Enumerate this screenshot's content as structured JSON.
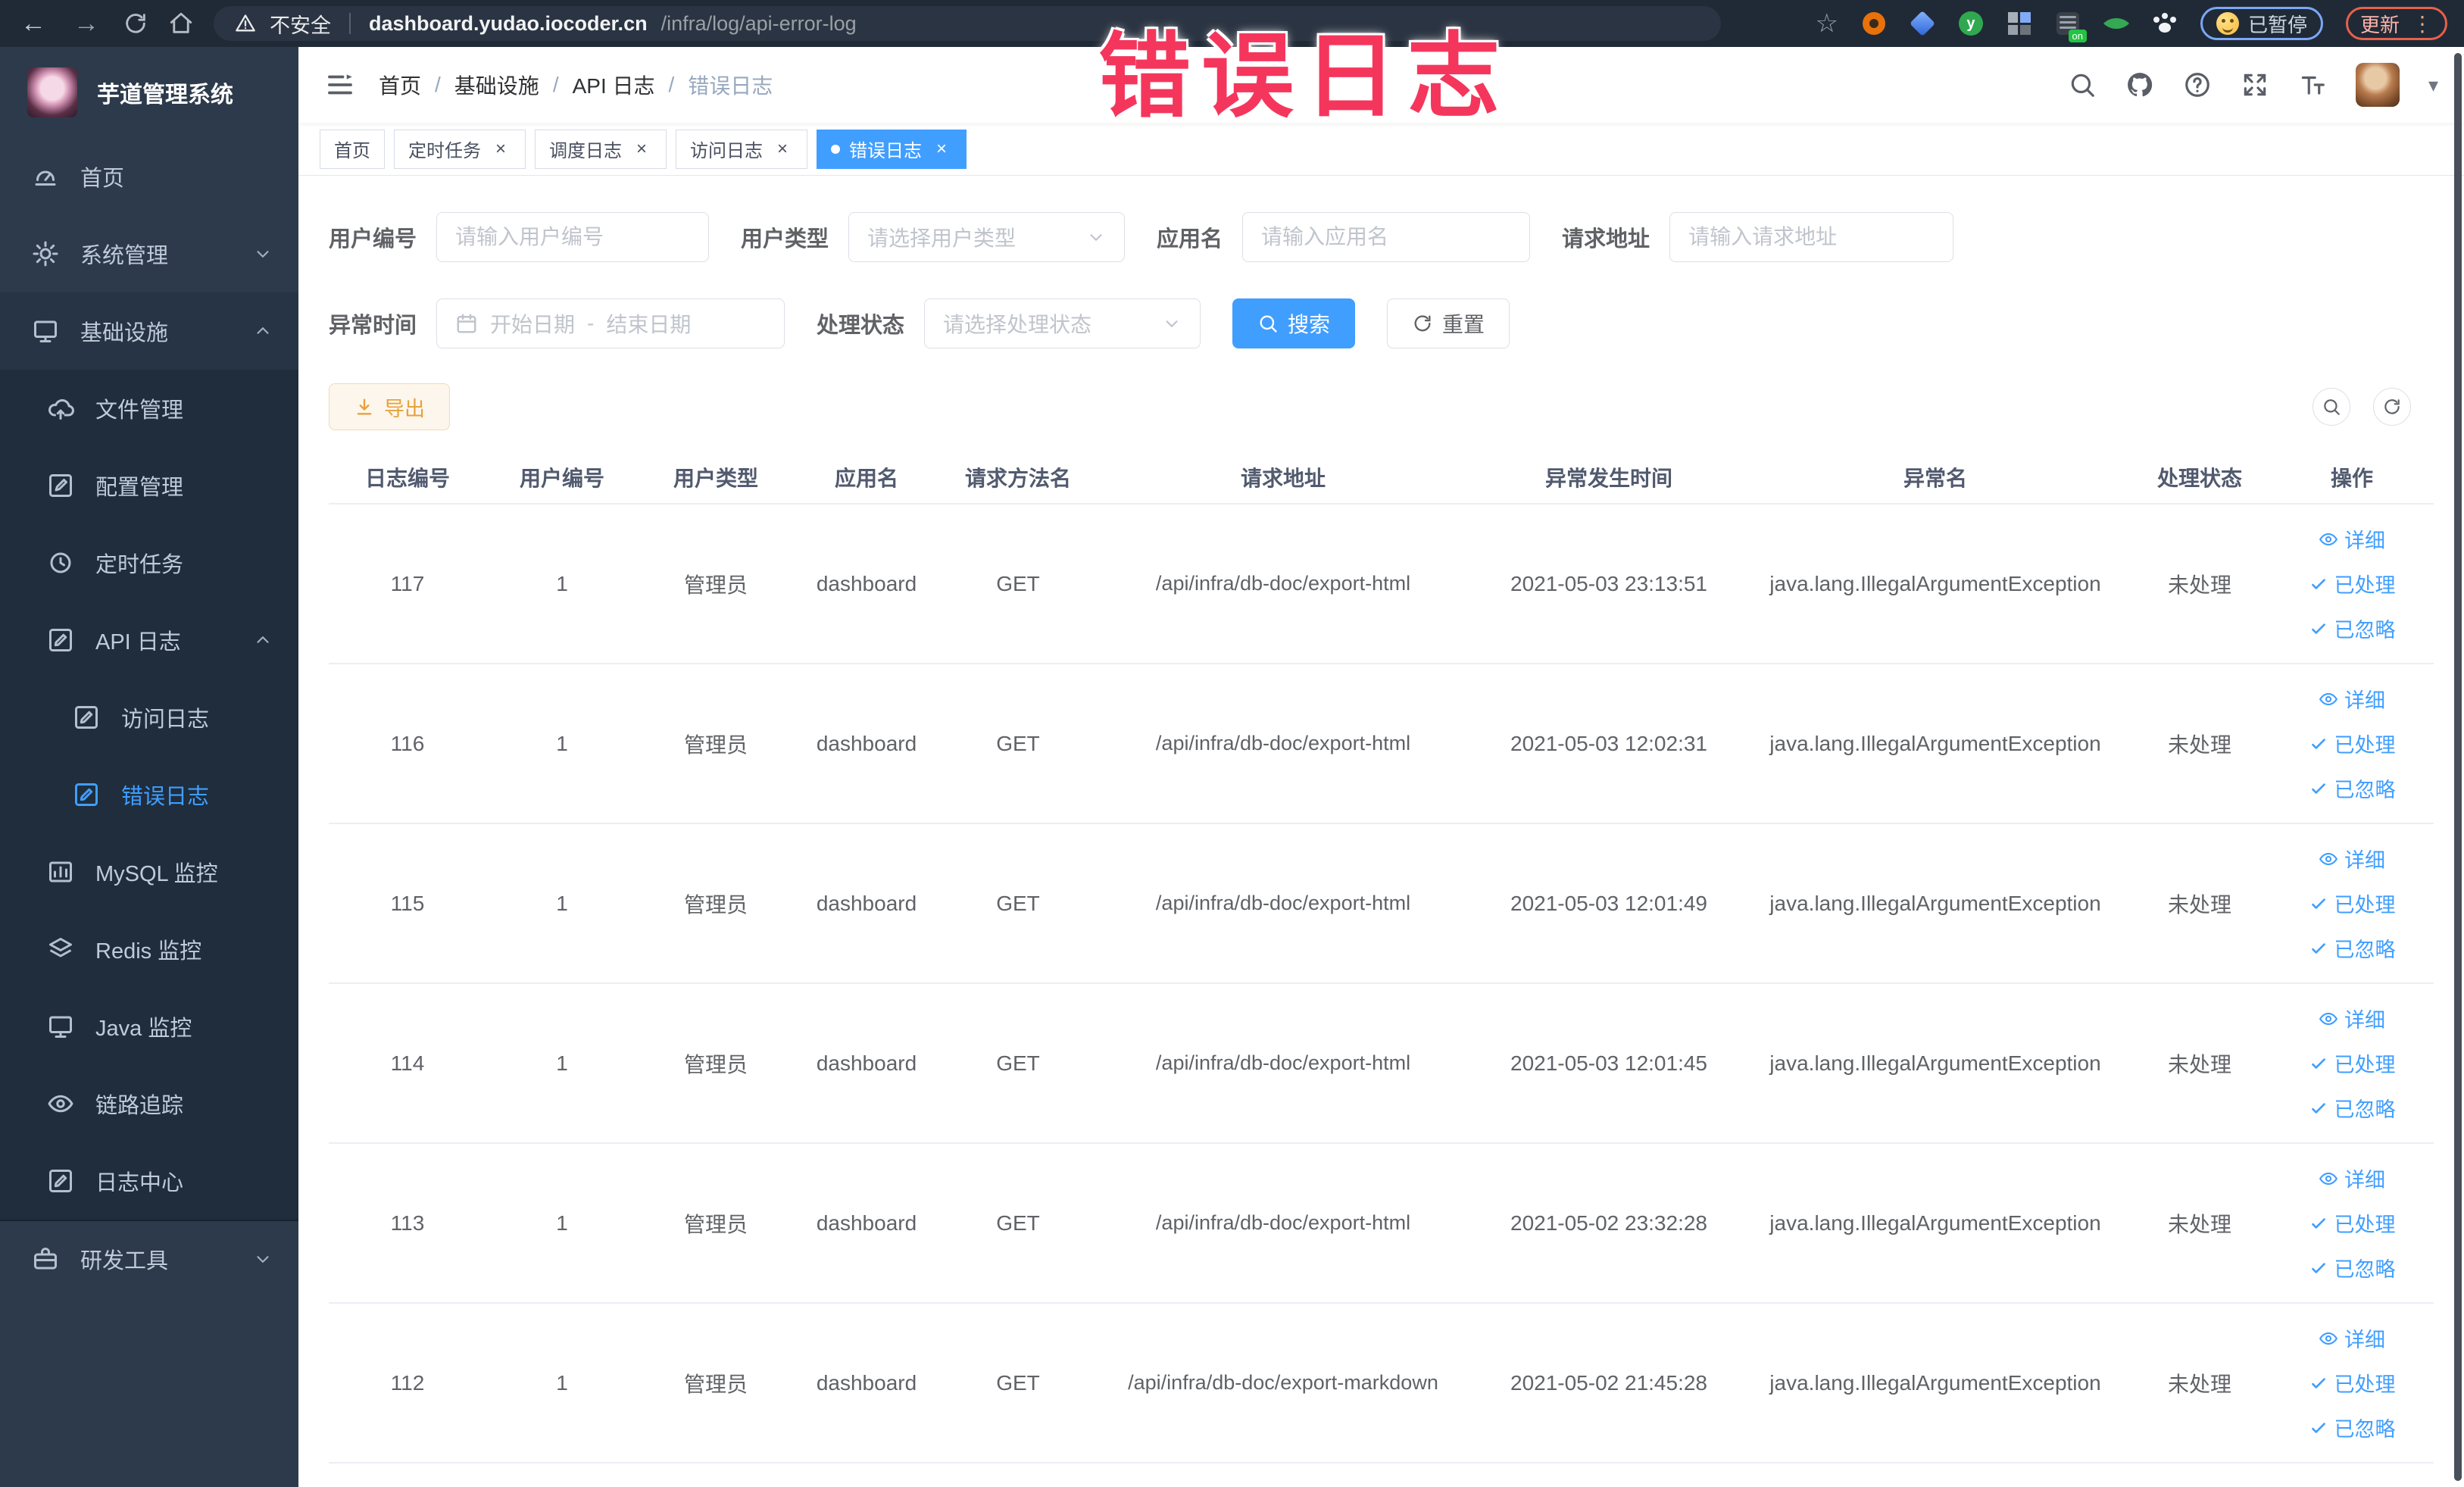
{
  "browser": {
    "back_glyph": "←",
    "forward_glyph": "→",
    "security_label": "不安全",
    "url_domain": "dashboard.yudao.iocoder.cn",
    "url_path": "/infra/log/api-error-log",
    "star_glyph": "☆",
    "extension_green_letter": "y",
    "extension_on_badge": "on",
    "paused_badge": "已暂停",
    "update_button": "更新",
    "menu_dots": "⋮"
  },
  "annotation": {
    "text": "错误日志"
  },
  "sidebar": {
    "title": "芋道管理系统",
    "items": [
      {
        "label": "首页"
      },
      {
        "label": "系统管理"
      },
      {
        "label": "基础设施"
      },
      {
        "label": "文件管理"
      },
      {
        "label": "配置管理"
      },
      {
        "label": "定时任务"
      },
      {
        "label": "API 日志"
      },
      {
        "label": "访问日志"
      },
      {
        "label": "错误日志"
      },
      {
        "label": "MySQL 监控"
      },
      {
        "label": "Redis 监控"
      },
      {
        "label": "Java 监控"
      },
      {
        "label": "链路追踪"
      },
      {
        "label": "日志中心"
      },
      {
        "label": "研发工具"
      }
    ]
  },
  "header": {
    "breadcrumbs": [
      "首页",
      "基础设施",
      "API 日志",
      "错误日志"
    ],
    "separator": "/",
    "caret_glyph": "▾"
  },
  "tabs": [
    {
      "label": "首页"
    },
    {
      "label": "定时任务"
    },
    {
      "label": "调度日志"
    },
    {
      "label": "访问日志"
    },
    {
      "label": "错误日志"
    }
  ],
  "ui": {
    "close_glyph": "×"
  },
  "filters": {
    "user_id_label": "用户编号",
    "user_id_placeholder": "请输入用户编号",
    "user_type_label": "用户类型",
    "user_type_placeholder": "请选择用户类型",
    "app_name_label": "应用名",
    "app_name_placeholder": "请输入应用名",
    "request_url_label": "请求地址",
    "request_url_placeholder": "请输入请求地址",
    "time_label": "异常时间",
    "time_start_placeholder": "开始日期",
    "time_separator": "-",
    "time_end_placeholder": "结束日期",
    "status_label": "处理状态",
    "status_placeholder": "请选择处理状态",
    "search_button": "搜索",
    "reset_button": "重置"
  },
  "toolbar": {
    "export_button": "导出"
  },
  "table": {
    "headers": [
      "日志编号",
      "用户编号",
      "用户类型",
      "应用名",
      "请求方法名",
      "请求地址",
      "异常发生时间",
      "异常名",
      "处理状态",
      "操作"
    ],
    "actions": {
      "detail": "详细",
      "processed": "已处理",
      "ignored": "已忽略"
    },
    "rows": [
      {
        "cells": [
          "117",
          "1",
          "管理员",
          "dashboard",
          "GET",
          "/api/infra/db-doc/export-html",
          "2021-05-03 23:13:51",
          "java.lang.IllegalArgumentException",
          "未处理"
        ]
      },
      {
        "cells": [
          "116",
          "1",
          "管理员",
          "dashboard",
          "GET",
          "/api/infra/db-doc/export-html",
          "2021-05-03 12:02:31",
          "java.lang.IllegalArgumentException",
          "未处理"
        ]
      },
      {
        "cells": [
          "115",
          "1",
          "管理员",
          "dashboard",
          "GET",
          "/api/infra/db-doc/export-html",
          "2021-05-03 12:01:49",
          "java.lang.IllegalArgumentException",
          "未处理"
        ]
      },
      {
        "cells": [
          "114",
          "1",
          "管理员",
          "dashboard",
          "GET",
          "/api/infra/db-doc/export-html",
          "2021-05-03 12:01:45",
          "java.lang.IllegalArgumentException",
          "未处理"
        ]
      },
      {
        "cells": [
          "113",
          "1",
          "管理员",
          "dashboard",
          "GET",
          "/api/infra/db-doc/export-html",
          "2021-05-02 23:32:28",
          "java.lang.IllegalArgumentException",
          "未处理"
        ]
      },
      {
        "cells": [
          "112",
          "1",
          "管理员",
          "dashboard",
          "GET",
          "/api/infra/db-doc/export-markdown",
          "2021-05-02 21:45:28",
          "java.lang.IllegalArgumentException",
          "未处理"
        ]
      }
    ]
  },
  "colors": {
    "accent": "#409eff",
    "annotation": "#f5365c",
    "export_text": "#e6a23c",
    "sidebar_bg": "#2d3a4b"
  }
}
